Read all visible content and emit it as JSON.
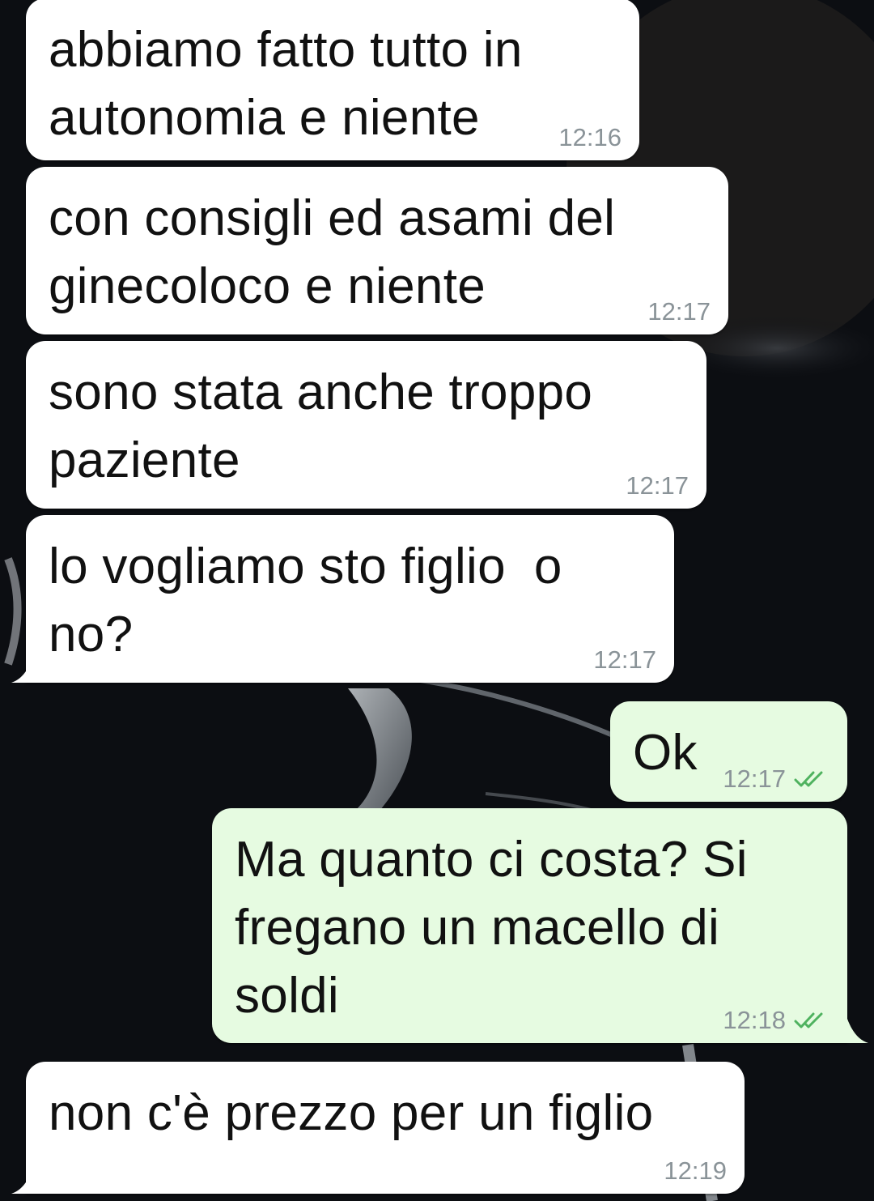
{
  "colors": {
    "wallpaper": "#0c0e12",
    "incoming_bubble": "#ffffff",
    "outgoing_bubble": "#e6fbe1",
    "timestamp": "#8a9398",
    "read_ticks": "#4fb25f"
  },
  "messages": [
    {
      "direction": "incoming",
      "text": "abbiamo fatto tutto in\nautonomia e niente",
      "time": "12:16"
    },
    {
      "direction": "incoming",
      "text": "con consigli ed asami del\nginecoloco e niente",
      "time": "12:17"
    },
    {
      "direction": "incoming",
      "text": "sono stata anche troppo\npaziente",
      "time": "12:17"
    },
    {
      "direction": "incoming",
      "text": "lo vogliamo sto figlio  o\nno?",
      "time": "12:17"
    },
    {
      "direction": "outgoing",
      "text": "Ok",
      "time": "12:17",
      "status_icon": "double-check-read-icon"
    },
    {
      "direction": "outgoing",
      "text": "Ma quanto ci costa? Si\nfregano un macello di\nsoldi",
      "time": "12:18",
      "status_icon": "double-check-read-icon"
    },
    {
      "direction": "incoming",
      "text": "non c'è prezzo per un figlio",
      "time": "12:19"
    }
  ]
}
